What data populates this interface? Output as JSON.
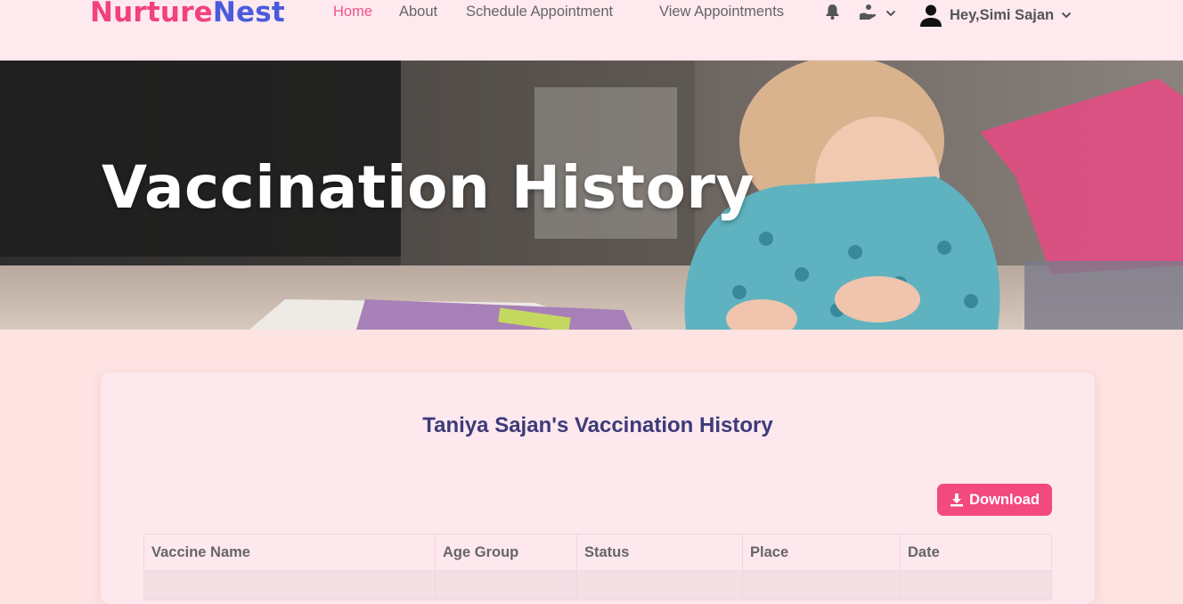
{
  "brand": {
    "part1": "Nurture",
    "part2": "Nest"
  },
  "nav": {
    "home": "Home",
    "about": "About",
    "schedule": "Schedule Appointment",
    "view": "View Appointments"
  },
  "user": {
    "greeting": "Hey,Simi Sajan"
  },
  "hero": {
    "title": "Vaccination History"
  },
  "card": {
    "title": "Taniya Sajan's Vaccination History",
    "download_label": "Download"
  },
  "table": {
    "headers": [
      "Vaccine Name",
      "Age Group",
      "Status",
      "Place",
      "Date"
    ]
  },
  "colors": {
    "accent": "#f2417e",
    "brand_blue": "#4a5bdc",
    "title": "#3d3a7a"
  }
}
